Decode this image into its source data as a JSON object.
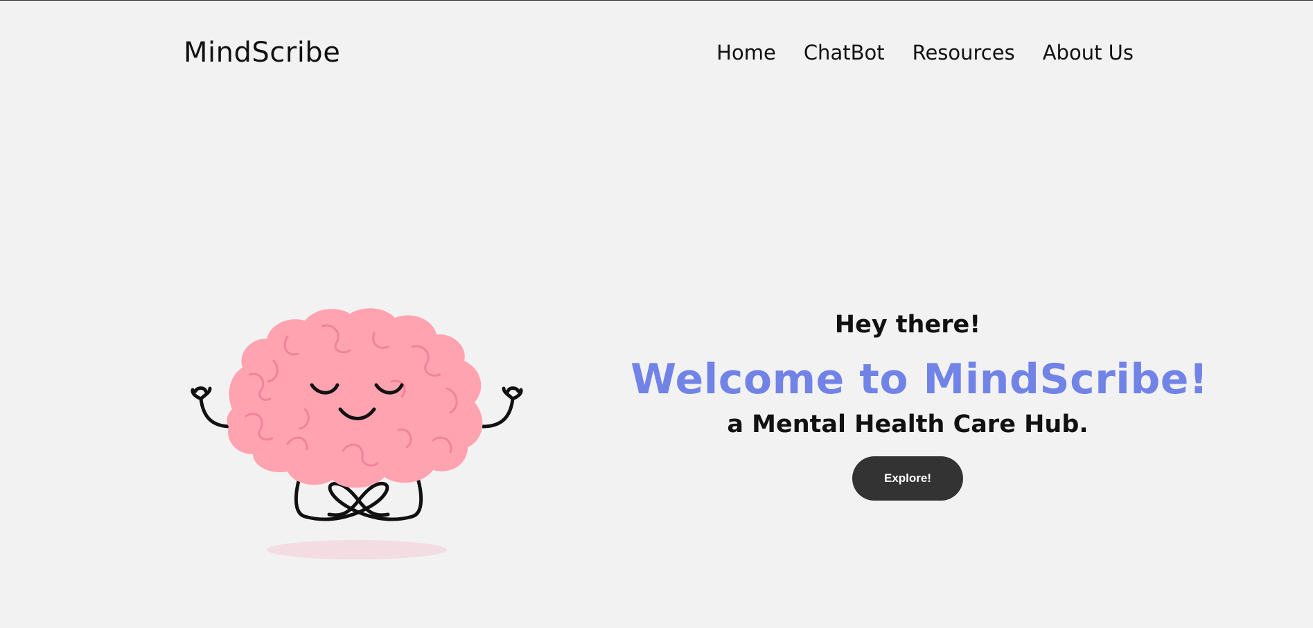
{
  "brand": {
    "name": "MindScribe"
  },
  "nav": {
    "items": [
      {
        "label": "Home"
      },
      {
        "label": "ChatBot"
      },
      {
        "label": "Resources"
      },
      {
        "label": "About Us"
      }
    ]
  },
  "hero": {
    "greeting": "Hey there!",
    "welcome": "Welcome to MindScribe!",
    "tagline": "a Mental Health Care Hub.",
    "cta_label": "Explore!"
  },
  "illustration": {
    "icon": "meditating-brain-icon"
  },
  "colors": {
    "background": "#f2f2f2",
    "accent": "#7183e6",
    "button": "#333333",
    "brain": "#ffa3b1"
  }
}
